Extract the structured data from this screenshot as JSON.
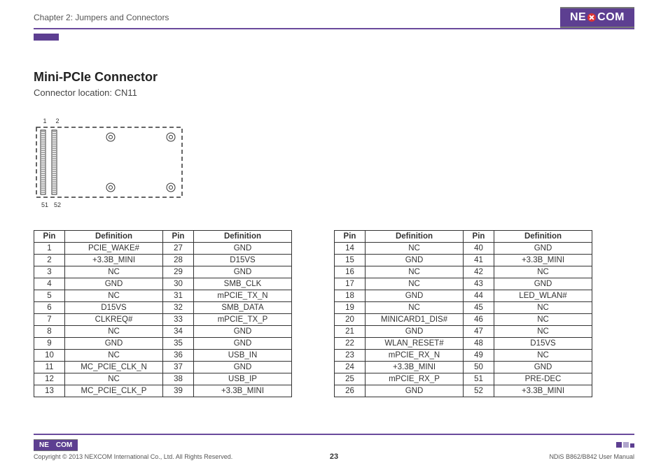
{
  "header": {
    "chapter": "Chapter 2: Jumpers and Connectors",
    "logo_text_left": "NE",
    "logo_text_right": "COM"
  },
  "section": {
    "title": "Mini-PCIe Connector",
    "location": "Connector location: CN11"
  },
  "diagram": {
    "labels": {
      "tl": "1",
      "tr": "2",
      "bl": "51",
      "br": "52"
    }
  },
  "table_headers": {
    "pin": "Pin",
    "definition": "Definition"
  },
  "pins_left": [
    {
      "p": "1",
      "d": "PCIE_WAKE#",
      "p2": "27",
      "d2": "GND"
    },
    {
      "p": "2",
      "d": "+3.3B_MINI",
      "p2": "28",
      "d2": "D15VS"
    },
    {
      "p": "3",
      "d": "NC",
      "p2": "29",
      "d2": "GND"
    },
    {
      "p": "4",
      "d": "GND",
      "p2": "30",
      "d2": "SMB_CLK"
    },
    {
      "p": "5",
      "d": "NC",
      "p2": "31",
      "d2": "mPCIE_TX_N"
    },
    {
      "p": "6",
      "d": "D15VS",
      "p2": "32",
      "d2": "SMB_DATA"
    },
    {
      "p": "7",
      "d": "CLKREQ#",
      "p2": "33",
      "d2": "mPCIE_TX_P"
    },
    {
      "p": "8",
      "d": "NC",
      "p2": "34",
      "d2": "GND"
    },
    {
      "p": "9",
      "d": "GND",
      "p2": "35",
      "d2": "GND"
    },
    {
      "p": "10",
      "d": "NC",
      "p2": "36",
      "d2": "USB_IN"
    },
    {
      "p": "11",
      "d": "MC_PCIE_CLK_N",
      "p2": "37",
      "d2": "GND"
    },
    {
      "p": "12",
      "d": "NC",
      "p2": "38",
      "d2": "USB_IP"
    },
    {
      "p": "13",
      "d": "MC_PCIE_CLK_P",
      "p2": "39",
      "d2": "+3.3B_MINI"
    }
  ],
  "pins_right": [
    {
      "p": "14",
      "d": "NC",
      "p2": "40",
      "d2": "GND"
    },
    {
      "p": "15",
      "d": "GND",
      "p2": "41",
      "d2": "+3.3B_MINI"
    },
    {
      "p": "16",
      "d": "NC",
      "p2": "42",
      "d2": "NC"
    },
    {
      "p": "17",
      "d": "NC",
      "p2": "43",
      "d2": "GND"
    },
    {
      "p": "18",
      "d": "GND",
      "p2": "44",
      "d2": "LED_WLAN#"
    },
    {
      "p": "19",
      "d": "NC",
      "p2": "45",
      "d2": "NC"
    },
    {
      "p": "20",
      "d": "MINICARD1_DIS#",
      "p2": "46",
      "d2": "NC"
    },
    {
      "p": "21",
      "d": "GND",
      "p2": "47",
      "d2": "NC"
    },
    {
      "p": "22",
      "d": "WLAN_RESET#",
      "p2": "48",
      "d2": "D15VS"
    },
    {
      "p": "23",
      "d": "mPCIE_RX_N",
      "p2": "49",
      "d2": "NC"
    },
    {
      "p": "24",
      "d": "+3.3B_MINI",
      "p2": "50",
      "d2": "GND"
    },
    {
      "p": "25",
      "d": "mPCIE_RX_P",
      "p2": "51",
      "d2": "PRE-DEC"
    },
    {
      "p": "26",
      "d": "GND",
      "p2": "52",
      "d2": "+3.3B_MINI"
    }
  ],
  "footer": {
    "copyright": "Copyright © 2013 NEXCOM International Co., Ltd. All Rights Reserved.",
    "page": "23",
    "manual": "NDiS B862/B842 User Manual"
  }
}
